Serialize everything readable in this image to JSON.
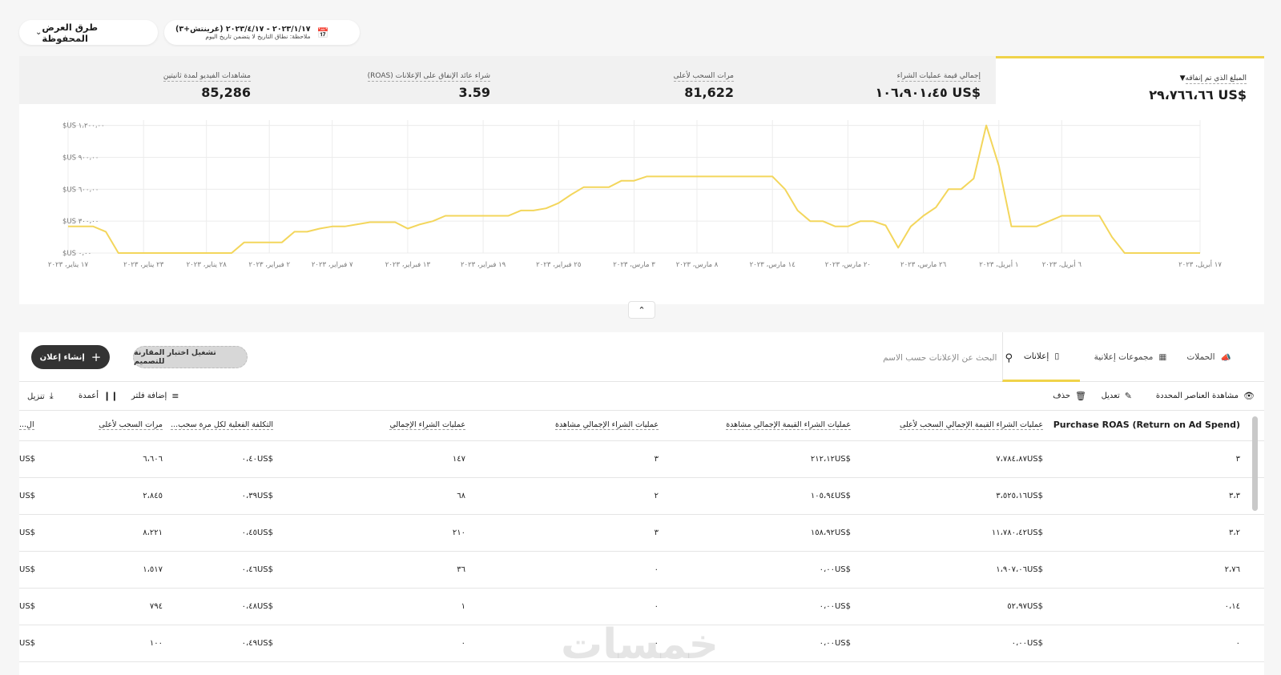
{
  "saved_views": {
    "label": "طرق العرض المحفوظة",
    "chevron_icon": "chevron-down-icon"
  },
  "date_range": {
    "range": "٢٠٢٣/١/١٧ - ٢٠٢٣/٤/١٧ (غرينتش+٣)",
    "note": "ملاحظة: نطاق التاريخ لا يتضمن تاريخ اليوم",
    "icon": "calendar-icon"
  },
  "metrics": [
    {
      "label": "المبلغ الذي تم إنفاقه",
      "value": "$US ٢٩،٧٦٦،٦٦",
      "active": true
    },
    {
      "label": "إجمالي قيمة عمليات الشراء",
      "value": "$US ١٠٦،٩٠١،٤٥",
      "active": false
    },
    {
      "label": "مرات السحب لأعلى",
      "value": "81,622",
      "active": false
    },
    {
      "label": "شراء عائد الإنفاق على الإعلانات (ROAS)",
      "value": "3.59",
      "active": false
    },
    {
      "label": "مشاهدات الفيديو لمدة ثانيتين",
      "value": "85,286",
      "active": false
    }
  ],
  "chart_data": {
    "type": "line",
    "title": "",
    "xlabel": "",
    "ylabel": "",
    "color": "#f3d65c",
    "ylim": [
      0,
      1250
    ],
    "yticks": [
      0,
      300,
      600,
      900,
      1200
    ],
    "ytick_labels": [
      "$US ٠،٠٠",
      "$US ٣٠٠،٠٠",
      "$US ٦٠٠،٠٠",
      "$US ٩٠٠،٠٠",
      "$US ١،٢٠٠،٠٠"
    ],
    "xtick_labels": [
      "١٧ يناير، ٢٠٢٣",
      "٢٣ يناير، ٢٠٢٣",
      "٢٨ يناير، ٢٠٢٣",
      "٢ فبراير، ٢٠٢٣",
      "٧ فبراير، ٢٠٢٣",
      "١٣ فبراير، ٢٠٢٣",
      "١٩ فبراير، ٢٠٢٣",
      "٢٥ فبراير، ٢٠٢٣",
      "٣ مارس، ٢٠٢٣",
      "٨ مارس، ٢٠٢٣",
      "١٤ مارس، ٢٠٢٣",
      "٢٠ مارس، ٢٠٢٣",
      "٢٦ مارس، ٢٠٢٣",
      "١ أبريل، ٢٠٢٣",
      "٦ أبريل، ٢٠٢٣",
      "١٧ أبريل، ٢٠٢٣"
    ],
    "xtick_days": [
      0,
      6,
      11,
      16,
      21,
      27,
      33,
      39,
      45,
      50,
      56,
      62,
      68,
      74,
      79,
      90
    ],
    "x_days": [
      0,
      1,
      2,
      3,
      4,
      5,
      6,
      7,
      8,
      9,
      10,
      11,
      12,
      13,
      14,
      15,
      16,
      17,
      18,
      19,
      20,
      21,
      22,
      23,
      24,
      25,
      26,
      27,
      28,
      29,
      30,
      31,
      32,
      33,
      34,
      35,
      36,
      37,
      38,
      39,
      40,
      41,
      42,
      43,
      44,
      45,
      46,
      47,
      48,
      49,
      50,
      51,
      52,
      53,
      54,
      55,
      56,
      57,
      58,
      59,
      60,
      61,
      62,
      63,
      64,
      65,
      66,
      67,
      68,
      69,
      70,
      71,
      72,
      73,
      74,
      75,
      76,
      77,
      78,
      79,
      80,
      81,
      82,
      83,
      84,
      85,
      86,
      87,
      88,
      89,
      90
    ],
    "values": [
      250,
      250,
      250,
      200,
      0,
      0,
      0,
      0,
      0,
      0,
      0,
      0,
      0,
      0,
      100,
      100,
      100,
      100,
      200,
      200,
      230,
      250,
      250,
      270,
      290,
      290,
      290,
      230,
      270,
      300,
      350,
      350,
      350,
      350,
      350,
      350,
      400,
      400,
      420,
      470,
      550,
      620,
      620,
      620,
      680,
      680,
      720,
      720,
      720,
      720,
      720,
      720,
      720,
      720,
      720,
      720,
      720,
      600,
      400,
      300,
      300,
      250,
      250,
      300,
      300,
      260,
      50,
      250,
      350,
      430,
      600,
      600,
      700,
      1200,
      820,
      250,
      250,
      250,
      300,
      350,
      350,
      350,
      350,
      150,
      0,
      0,
      0,
      0,
      0,
      0,
      0
    ]
  },
  "tabs": [
    {
      "label": "الحملات",
      "icon": "megaphone-icon",
      "active": false
    },
    {
      "label": "مجموعات إعلانية",
      "icon": "grid-icon",
      "active": false
    },
    {
      "label": "إعلانات",
      "icon": "phone-icon",
      "active": true
    }
  ],
  "search": {
    "placeholder": "البحث عن الإعلانات حسب الاسم",
    "value": "",
    "icon": "search-icon"
  },
  "compare_button": "تشغيل اختبار المقارنة للتصميم",
  "create_button": "إنشاء إعلان",
  "toolbar": {
    "view_selected": "مشاهدة العناصر المحددة",
    "edit": "تعديل",
    "delete": "حذف",
    "add_filter": "إضافة فلتر",
    "columns": "أعمدة",
    "download": "تنزيل"
  },
  "table": {
    "columns": [
      "Purchase ROAS (Return on Ad Spend)",
      "عمليات الشراء القيمة الإجمالي السحب لأعلى",
      "عمليات الشراء القيمة الإجمالي مشاهدة",
      "عمليات الشراء الإجمالي مشاهدة",
      "عمليات الشراء الإجمالي",
      "التكلفة الفعلية لكل مرة سحب...",
      "مرات السحب لأعلى",
      "ال..."
    ],
    "rows": [
      [
        "٣",
        "٧،٧٨٤،٨٧US$",
        "٢١٢،١٢US$",
        "٣",
        "١٤٧",
        "٠،٤٠US$",
        "٦،٦٠٦",
        "US$"
      ],
      [
        "٣،٣",
        "٣،٥٢٥،١٦US$",
        "١٠٥،٩٤US$",
        "٢",
        "٦٨",
        "٠،٣٩US$",
        "٢،٨٤٥",
        "US$"
      ],
      [
        "٣،٢",
        "١١،٧٨٠،٤٢US$",
        "١٥٨،٩٢US$",
        "٣",
        "٢١٠",
        "٠،٤٥US$",
        "٨،٢٢١",
        "US$"
      ],
      [
        "٢،٧٦",
        "١،٩٠٧،٠٦US$",
        "٠،٠٠US$",
        "٠",
        "٣٦",
        "٠،٤٦US$",
        "١،٥١٧",
        "US$"
      ],
      [
        "٠،١٤",
        "٥٢،٩٧US$",
        "٠،٠٠US$",
        "٠",
        "١",
        "٠،٤٨US$",
        "٧٩٤",
        "US$"
      ],
      [
        "٠",
        "٠،٠٠US$",
        "٠،٠٠US$",
        "٠",
        "٠",
        "٠،٤٩US$",
        "١٠٠",
        "US$"
      ]
    ]
  },
  "watermark": "خمسات",
  "accent_color": "#f0d34a"
}
